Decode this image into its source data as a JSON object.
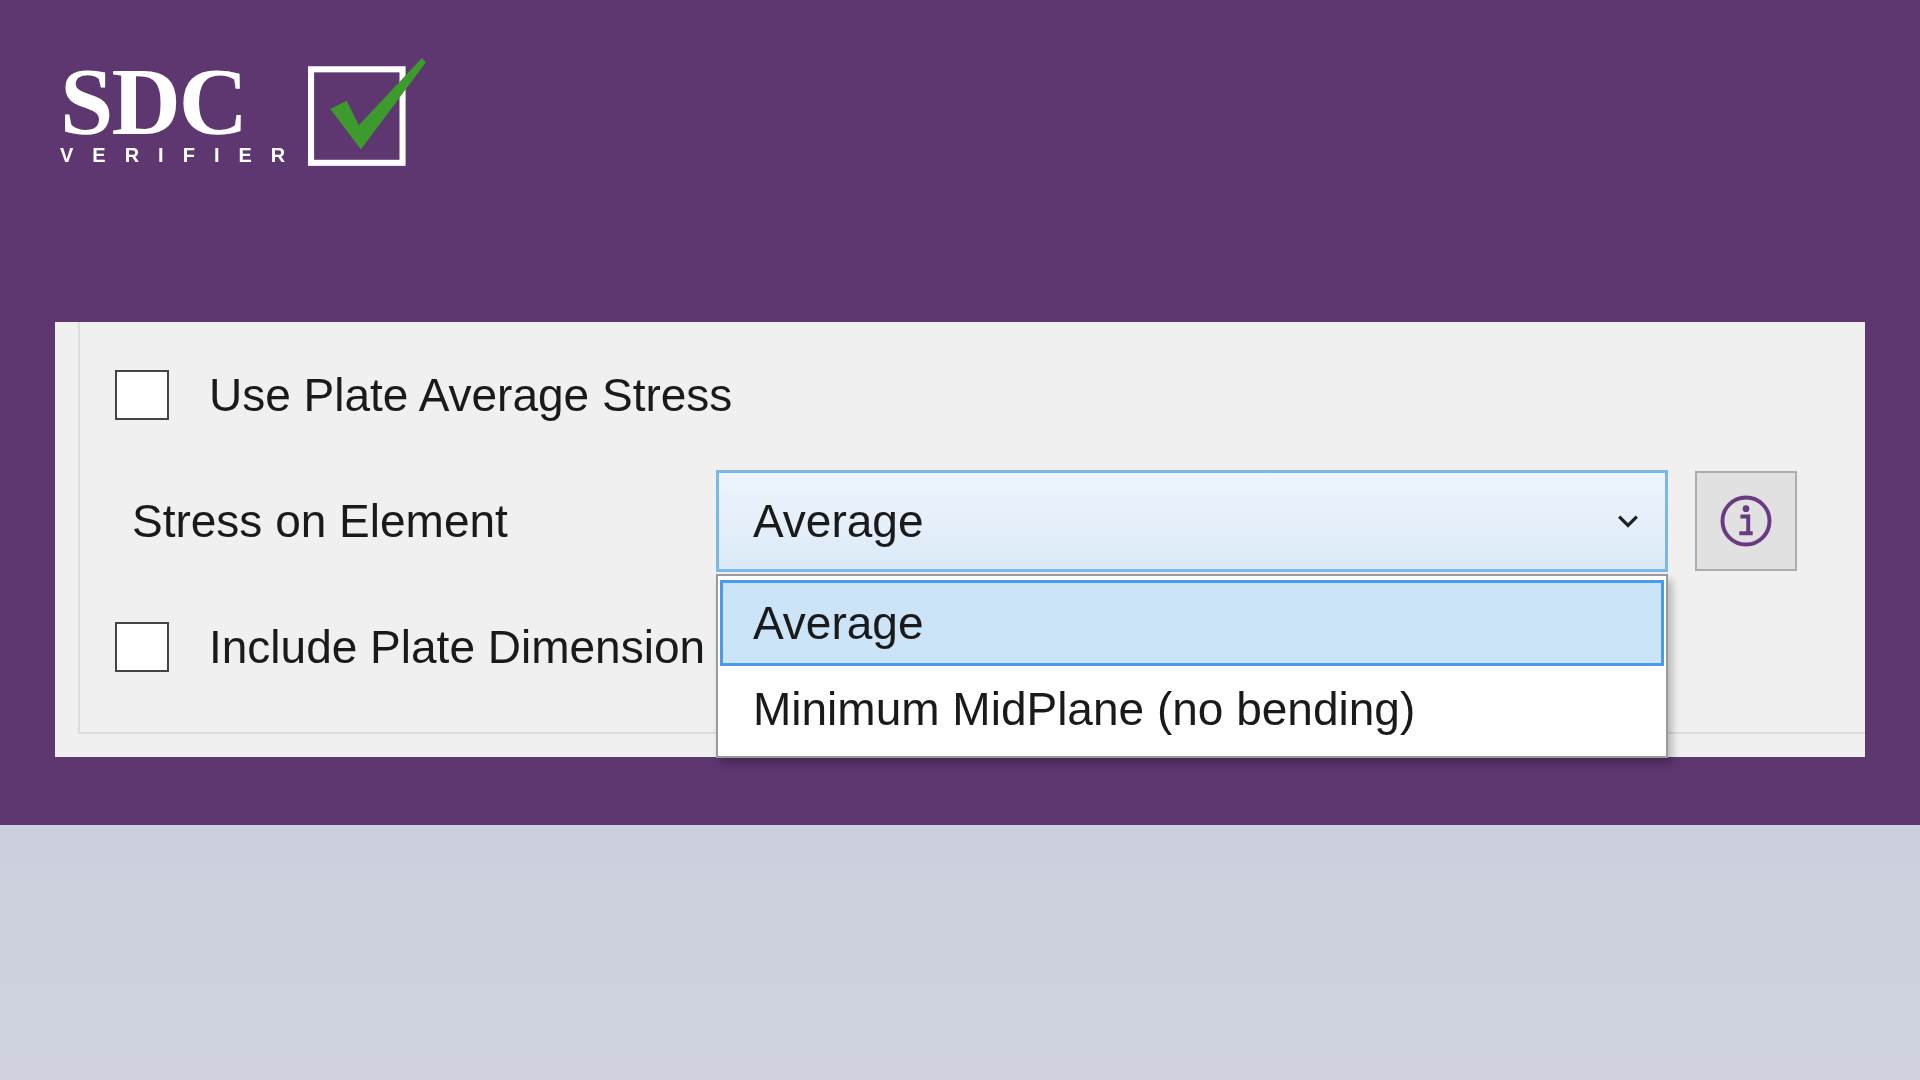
{
  "logo": {
    "name": "SDC",
    "tagline": "VERIFIER"
  },
  "options": [
    {
      "kind": "checkbox",
      "label": "Use Plate Average Stress",
      "checked": false
    },
    {
      "kind": "combo",
      "label": "Stress on Element",
      "value": "Average",
      "expanded": true,
      "items": [
        {
          "label": "Average",
          "selected": true
        },
        {
          "label": "Minimum MidPlane (no bending)",
          "selected": false
        }
      ]
    },
    {
      "kind": "checkbox",
      "label": "Include Plate Dimension",
      "checked": false
    }
  ]
}
